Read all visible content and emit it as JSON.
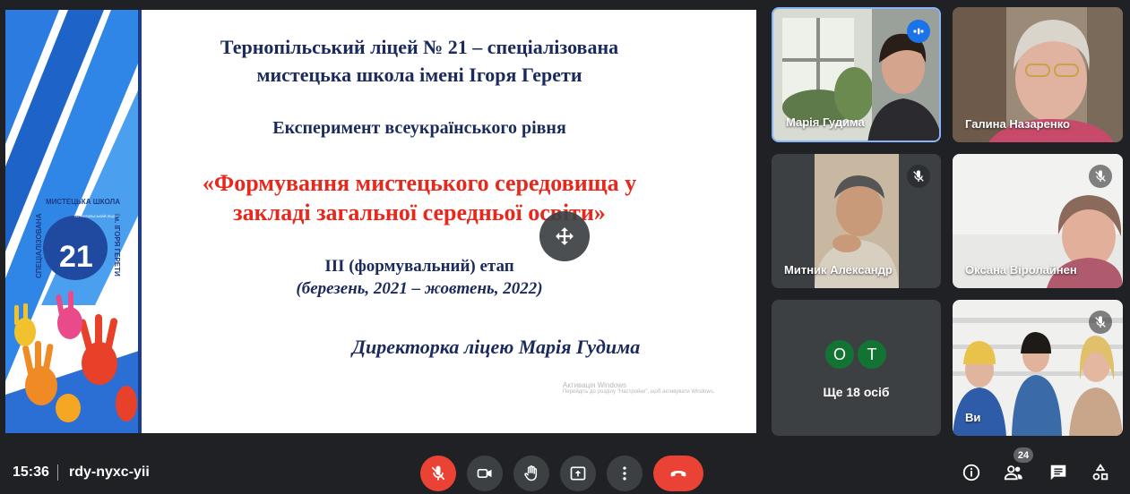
{
  "slide": {
    "title_line1": "Тернопільський ліцей № 21 – спеціалізована",
    "title_line2": "мистецька школа імені Ігоря Герети",
    "experiment": "Експеримент всеукраїнського рівня",
    "quote_line1": "«Формування мистецького середовища у",
    "quote_line2": "закладі загальної середньої освіти»",
    "stage_line1": "ІІІ (формувальний) етап",
    "stage_line2": "(березень, 2021 – жовтень, 2022)",
    "director": "Директорка ліцею Марія Гудима",
    "logo_top": "МИСТЕЦЬКА ШКОЛА",
    "logo_number": "21",
    "logo_left": "СПЕЦІАЛІЗОВАНА",
    "logo_right": "ім. ІГОРЯ ГЕРЕТИ",
    "logo_inner": "ТЕРНОПІЛЬСЬКИЙ ЛІЦЕЙ",
    "win_line1": "Активація Windows",
    "win_line2": "Перейдіть до розділу \"Настройки\", щоб активувати Windows."
  },
  "participants": [
    {
      "name": "Марія Гудима",
      "state": "speaking"
    },
    {
      "name": "Галина Назаренко",
      "state": "none"
    },
    {
      "name": "Митник Александр",
      "state": "muted"
    },
    {
      "name": "Оксана Віролайнен",
      "state": "muted"
    },
    {
      "name": "Ви",
      "state": "muted"
    }
  ],
  "more": {
    "avatars": [
      "О",
      "Т"
    ],
    "label": "Ще 18 осіб"
  },
  "bar": {
    "time": "15:36",
    "meeting_code": "rdy-nyxc-yii",
    "people_count": "24"
  },
  "colors": {
    "background": "#202124",
    "end_call": "#ea4335",
    "avatar_green": "#137333",
    "title_navy": "#1b2a5c",
    "quote_red": "#e8281d"
  },
  "icons": [
    "move-icon",
    "mic-off-icon",
    "camera-icon",
    "raise-hand-icon",
    "present-icon",
    "more-options-icon",
    "end-call-icon",
    "info-icon",
    "people-icon",
    "chat-icon",
    "activities-icon",
    "speaking-icon"
  ]
}
